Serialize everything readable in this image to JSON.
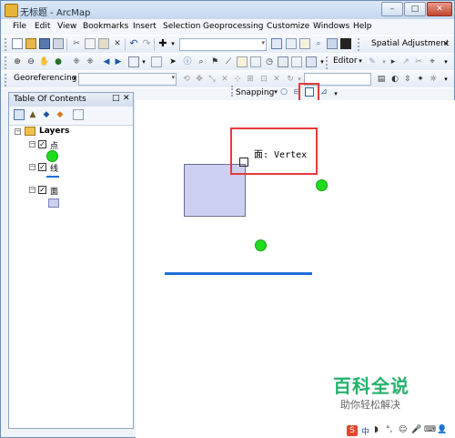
{
  "window": {
    "title": "无标题 - ArcMap",
    "minimize": "–",
    "maximize": "□",
    "close": "✕"
  },
  "menu": [
    "File",
    "Edit",
    "View",
    "Bookmarks",
    "Insert",
    "Selection",
    "Geoprocessing",
    "Customize",
    "Windows",
    "Help"
  ],
  "toolbar": {
    "spatial_adjustment": "Spatial Adjustment",
    "editor": "Editor",
    "georeferencing": "Georeferencing",
    "snapping": "Snapping"
  },
  "toc": {
    "title": "Table Of Contents",
    "pin": "□",
    "close": "✕",
    "root": "Layers",
    "layers": [
      {
        "name": "点",
        "type": "point"
      },
      {
        "name": "线",
        "type": "line"
      },
      {
        "name": "面",
        "type": "polygon"
      }
    ]
  },
  "map": {
    "snap_tip": "面: Vertex",
    "colors": {
      "point": "#1fdc1f",
      "line": "#1a6fd8",
      "polygon_fill": "#ccd0f2",
      "highlight": "#e53b3b"
    }
  },
  "watermark": {
    "title": "百科全说",
    "subtitle": "助你轻松解决"
  }
}
